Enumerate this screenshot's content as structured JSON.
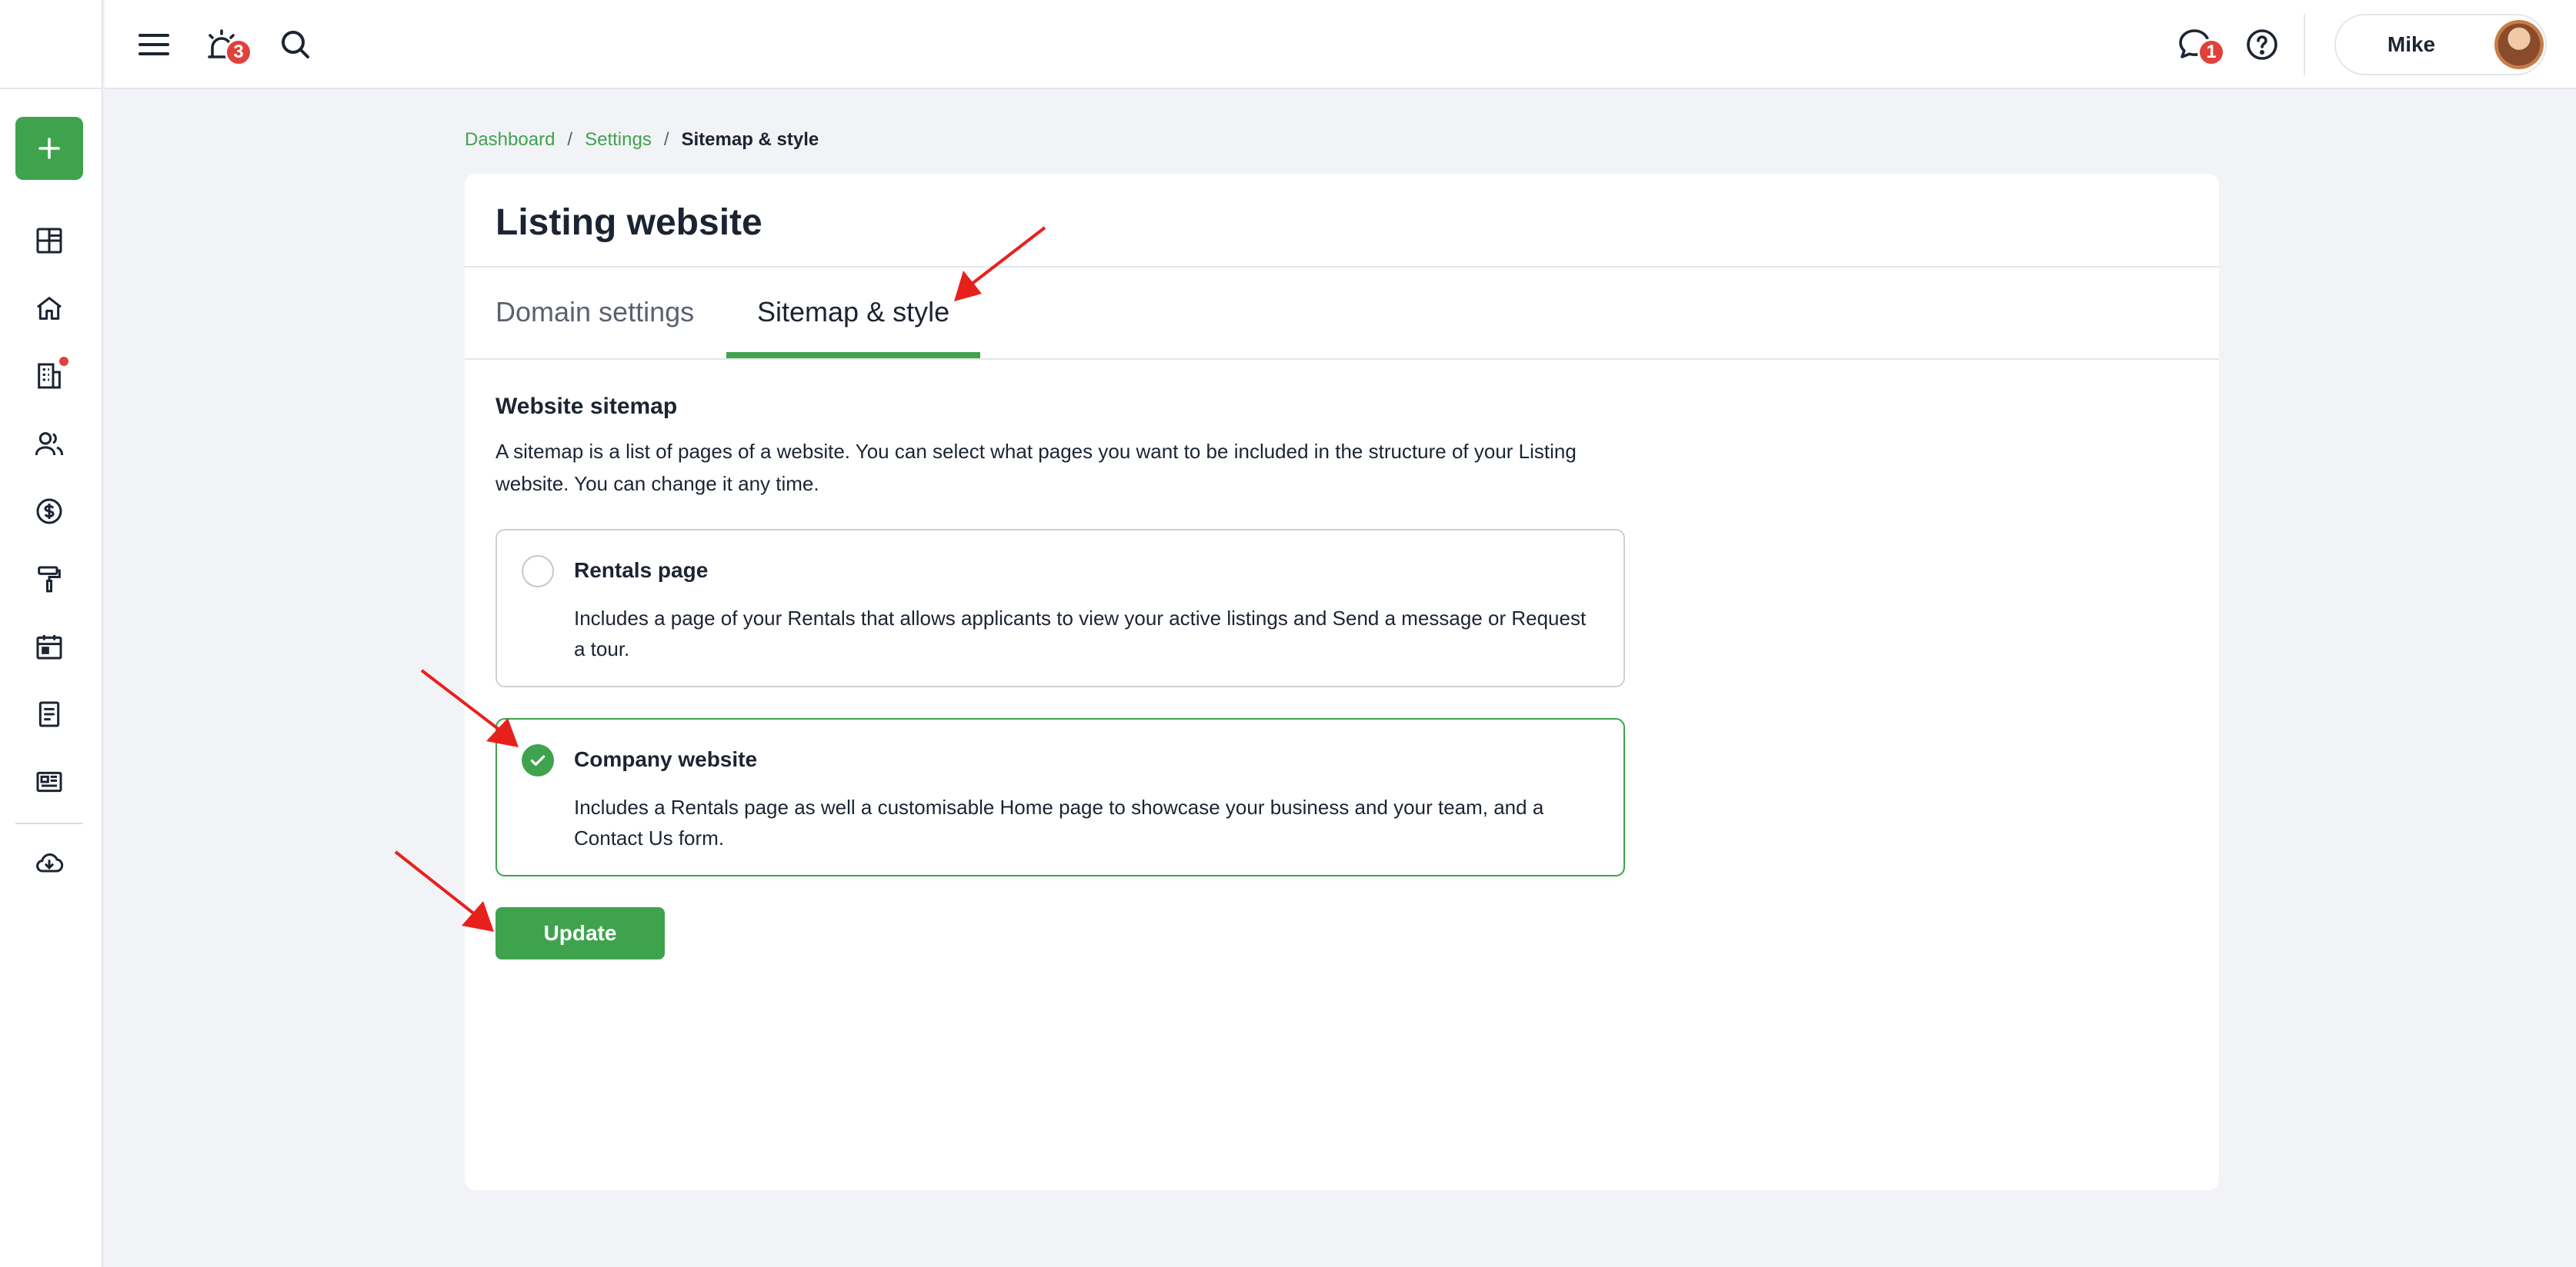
{
  "header": {
    "notifications_count": "3",
    "messages_count": "1",
    "user_name": "Mike"
  },
  "breadcrumb": {
    "items": [
      "Dashboard",
      "Settings"
    ],
    "separator": "/",
    "current": "Sitemap & style"
  },
  "card": {
    "title": "Listing website",
    "tabs": [
      {
        "label": "Domain settings",
        "active": false
      },
      {
        "label": "Sitemap & style",
        "active": true
      }
    ]
  },
  "sitemap": {
    "title": "Website sitemap",
    "description": "A sitemap is a list of pages of a website. You can select what pages you want to be included in the structure of your Listing website. You can change it any time.",
    "options": [
      {
        "label": "Rentals page",
        "description": "Includes a page of your Rentals that allows applicants to view your active listings and Send a message or Request a tour.",
        "selected": false
      },
      {
        "label": "Company website",
        "description": "Includes a Rentals page as well a customisable Home page to showcase your business and your team, and a Contact Us form.",
        "selected": true
      }
    ],
    "update_label": "Update"
  },
  "colors": {
    "accent": "#3fa34d",
    "badge": "#e2403b",
    "annotation_arrow": "#e8201c"
  },
  "sidebar": {
    "icons": [
      "plus-icon",
      "dashboard-grid-icon",
      "home-icon",
      "building-icon",
      "people-icon",
      "dollar-icon",
      "paint-roller-icon",
      "calendar-icon",
      "document-icon",
      "newspaper-icon",
      "cloud-download-icon"
    ]
  }
}
